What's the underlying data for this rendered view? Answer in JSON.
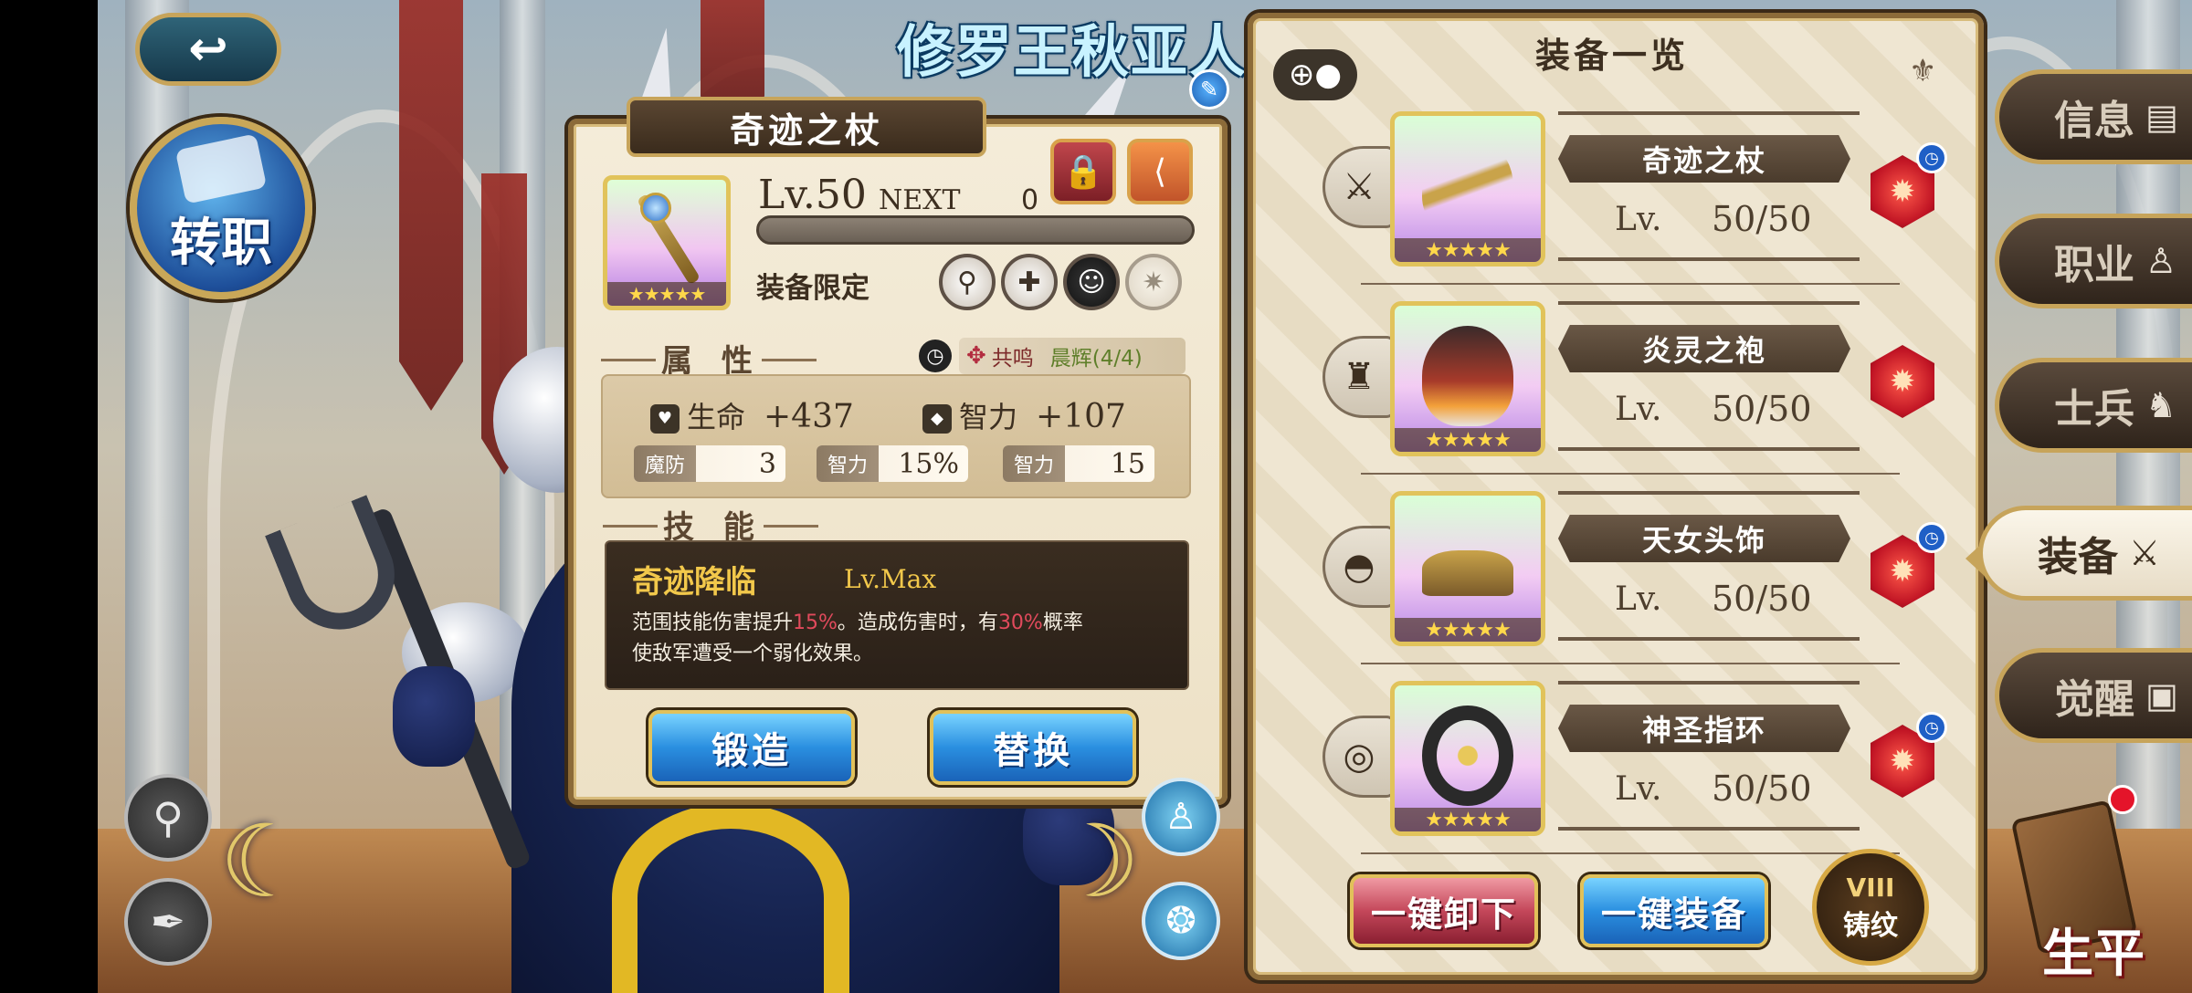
{
  "hero": {
    "name": "修罗王秋亚人"
  },
  "top_left": {
    "back_icon": "back-arrow-icon",
    "job_change_label": "转职"
  },
  "item_detail": {
    "title": "奇迹之杖",
    "level": "Lv.50",
    "next_label": "NEXT",
    "next_value": "0",
    "exp_progress": 0,
    "stars": "★★★★★",
    "restriction_label": "装备限定",
    "attributes_title": "属 性",
    "resonance_label": "共鸣",
    "resonance_name": "晨辉(4/4)",
    "main_stats": [
      {
        "label": "生命",
        "value": "+437"
      },
      {
        "label": "智力",
        "value": "+107"
      }
    ],
    "sub_stats": [
      {
        "label": "魔防",
        "value": "3"
      },
      {
        "label": "智力",
        "value": "15%"
      },
      {
        "label": "智力",
        "value": "15"
      }
    ],
    "skill_title": "技 能",
    "skill": {
      "name": "奇迹降临",
      "level": "Lv.Max",
      "desc_1": "范围技能伤害提升",
      "desc_hl_1": "15%",
      "desc_2": "。造成伤害时，有",
      "desc_hl_2": "30%",
      "desc_3": "概率",
      "desc_line2": "使敌军遭受一个弱化效果。"
    },
    "forge_label": "锻造",
    "replace_label": "替换"
  },
  "equipment": {
    "title": "装备一览",
    "slots": [
      {
        "type_icon": "sword-icon",
        "name": "奇迹之杖",
        "lv_label": "Lv.",
        "level": "50/50",
        "stars": "★★★★★",
        "has_timer": true
      },
      {
        "type_icon": "armor-icon",
        "name": "炎灵之袍",
        "lv_label": "Lv.",
        "level": "50/50",
        "stars": "★★★★★",
        "has_timer": false
      },
      {
        "type_icon": "helmet-icon",
        "name": "天女头饰",
        "lv_label": "Lv.",
        "level": "50/50",
        "stars": "★★★★★",
        "has_timer": true
      },
      {
        "type_icon": "ring-icon",
        "name": "神圣指环",
        "lv_label": "Lv.",
        "level": "50/50",
        "stars": "★★★★★",
        "has_timer": true
      }
    ],
    "unequip_all_label": "一键卸下",
    "equip_all_label": "一键装备",
    "forge_pattern_top": "VIII",
    "forge_pattern_label": "铸纹"
  },
  "side_menu": [
    {
      "label": "信息",
      "icon": "document-icon",
      "active": false
    },
    {
      "label": "职业",
      "icon": "person-icon",
      "active": false
    },
    {
      "label": "士兵",
      "icon": "soldier-icon",
      "active": false
    },
    {
      "label": "装备",
      "icon": "sword-shield-icon",
      "active": true
    },
    {
      "label": "觉醒",
      "icon": "portrait-icon",
      "active": false
    }
  ],
  "chronicle_label": "生平",
  "colors": {
    "accent_gold": "#c7a45a",
    "highlight_red": "#e14a5c",
    "skill_gold": "#f2c84b"
  }
}
